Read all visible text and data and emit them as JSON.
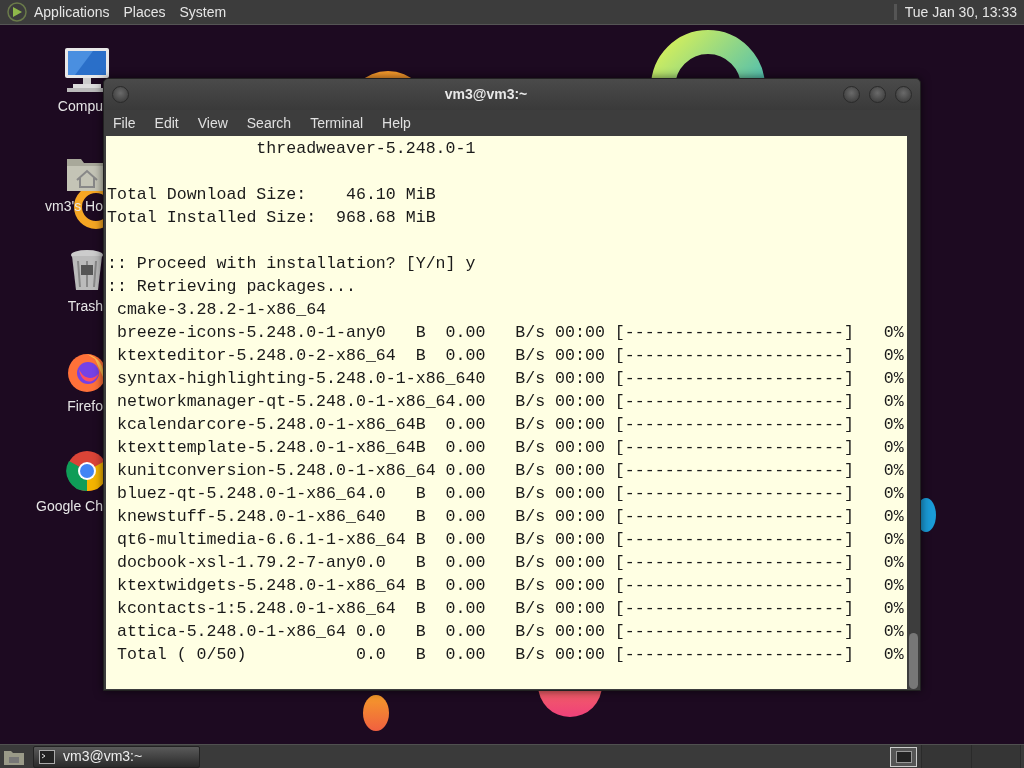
{
  "top_panel": {
    "menus": [
      "Applications",
      "Places",
      "System"
    ],
    "clock": "Tue Jan 30, 13:33"
  },
  "desktop": {
    "icons": [
      {
        "kind": "computer",
        "label": "Compu"
      },
      {
        "kind": "home",
        "label": "vm3's Ho"
      },
      {
        "kind": "trash",
        "label": "Trash"
      },
      {
        "kind": "firefox",
        "label": "Firefo"
      },
      {
        "kind": "chrome",
        "label": "Google Ch"
      }
    ]
  },
  "window": {
    "title": "vm3@vm3:~",
    "menu": [
      "File",
      "Edit",
      "View",
      "Search",
      "Terminal",
      "Help"
    ],
    "terminal_blocks": [
      [
        "               threadweaver-5.248.0-1"
      ],
      [
        "Total Download Size:    46.10 MiB",
        "Total Installed Size:  968.68 MiB"
      ],
      [
        ":: Proceed with installation? [Y/n] y",
        ":: Retrieving packages...",
        " cmake-3.28.2-1-x86_64",
        " breeze-icons-5.248.0-1-any0   B  0.00   B/s 00:00 [----------------------]   0%",
        " ktexteditor-5.248.0-2-x86_64  B  0.00   B/s 00:00 [----------------------]   0%",
        " syntax-highlighting-5.248.0-1-x86_640   B/s 00:00 [----------------------]   0%",
        " networkmanager-qt-5.248.0-1-x86_64.00   B/s 00:00 [----------------------]   0%",
        " kcalendarcore-5.248.0-1-x86_64B  0.00   B/s 00:00 [----------------------]   0%",
        " ktexttemplate-5.248.0-1-x86_64B  0.00   B/s 00:00 [----------------------]   0%",
        " kunitconversion-5.248.0-1-x86_64 0.00   B/s 00:00 [----------------------]   0%",
        " bluez-qt-5.248.0-1-x86_64.0   B  0.00   B/s 00:00 [----------------------]   0%",
        " knewstuff-5.248.0-1-x86_640   B  0.00   B/s 00:00 [----------------------]   0%",
        " qt6-multimedia-6.6.1-1-x86_64 B  0.00   B/s 00:00 [----------------------]   0%",
        " docbook-xsl-1.79.2-7-any0.0   B  0.00   B/s 00:00 [----------------------]   0%",
        " ktextwidgets-5.248.0-1-x86_64 B  0.00   B/s 00:00 [----------------------]   0%",
        " kcontacts-1:5.248.0-1-x86_64  B  0.00   B/s 00:00 [----------------------]   0%",
        " attica-5.248.0-1-x86_64 0.0   B  0.00   B/s 00:00 [----------------------]   0%",
        " Total ( 0/50)           0.0   B  0.00   B/s 00:00 [----------------------]   0%"
      ]
    ]
  },
  "taskbar": {
    "tasks": [
      {
        "label": "vm3@vm3:~",
        "selected": true
      }
    ]
  }
}
